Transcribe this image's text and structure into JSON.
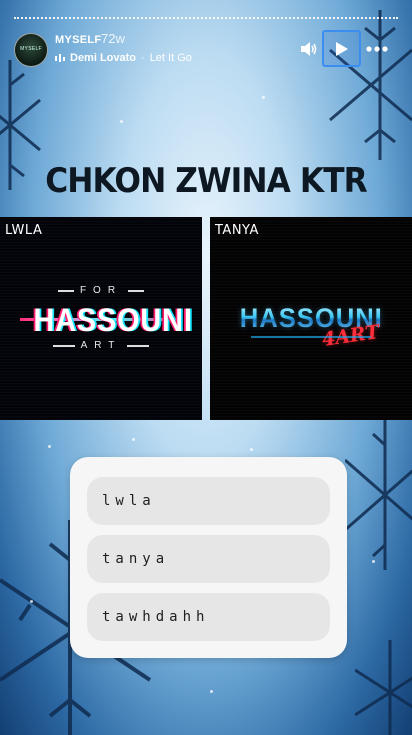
{
  "header": {
    "username": "MYSELF",
    "time": "72w",
    "music": {
      "artist": "Demi Lovato",
      "separator": "·",
      "song": "Let It Go"
    },
    "avatar_text": "MYSELF",
    "icons": {
      "sound": "speaker-icon",
      "play": "play-icon",
      "more": "more-dots-icon",
      "music": "music-bars-icon"
    }
  },
  "title": "CHKON ZWINA KTR",
  "panels": {
    "left": {
      "label": "LWLA",
      "logo_top": "FOR",
      "logo_main": "HASSOUNI",
      "logo_bottom": "ART"
    },
    "right": {
      "label": "TANYA",
      "logo_main": "HASSOUNI",
      "logo_accent": "4ART"
    }
  },
  "quiz": {
    "options": [
      "lwla",
      "tanya",
      "tawhdahh"
    ]
  },
  "colors": {
    "accent_blue": "#3b8df0",
    "sky": "#bcdcf2",
    "deep_blue": "#123f73"
  }
}
